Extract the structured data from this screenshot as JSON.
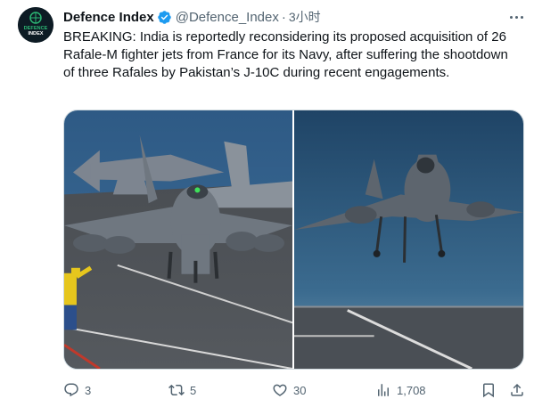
{
  "tweet": {
    "author": {
      "display_name": "Defence Index",
      "handle": "@Defence_Index",
      "verified": true,
      "avatar_text_line1": "DEFENCE",
      "avatar_text_line2": "INDEX"
    },
    "separator": "·",
    "time": "3小时",
    "text": "BREAKING: India is reportedly reconsidering its proposed acquisition of 26 Rafale-M fighter jets from France for its Navy, after suffering the shootdown of three Rafales by Pakistan’s J-10C during recent engagements.",
    "media": [
      {
        "type": "photo",
        "subject": "fighter-jets-on-carrier-deck"
      },
      {
        "type": "photo",
        "subject": "fighter-jet-landing-on-carrier"
      }
    ],
    "actions": {
      "replies": "3",
      "reposts": "5",
      "likes": "30",
      "views": "1,708"
    },
    "icons": [
      "more-icon",
      "verified-icon",
      "reply-icon",
      "repost-icon",
      "like-icon",
      "views-icon",
      "bookmark-icon",
      "share-icon"
    ],
    "colors": {
      "text": "#0f1419",
      "secondary": "#536471",
      "verified": "#1d9bf0",
      "border": "#cfd9de"
    }
  }
}
